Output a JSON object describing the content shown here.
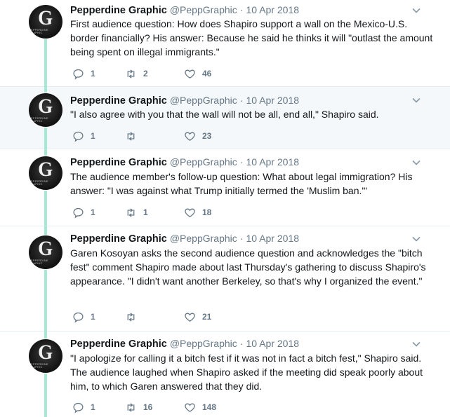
{
  "colors": {
    "thread_line": "#a5e8d4",
    "muted": "#657786",
    "text": "#14171a",
    "highlight_bg": "#f5f8fa"
  },
  "avatar": {
    "letter": "G",
    "sub": "PEPPERDINE GRAPHIC"
  },
  "tweets": [
    {
      "name": "Pepperdine Graphic",
      "handle": "@PeppGraphic",
      "sep": "·",
      "date": "10 Apr 2018",
      "text": "First audience question: How does Shapiro support a wall on the Mexico-U.S. border financially? His answer: Because he said he thinks it will \"outlast the amount being spent on illegal immigrants.\"",
      "replies": "1",
      "retweets": "2",
      "likes": "46"
    },
    {
      "name": "Pepperdine Graphic",
      "handle": "@PeppGraphic",
      "sep": "·",
      "date": "10 Apr 2018",
      "text": "\"I also agree with you that the wall will not be all, end all,\" Shapiro said.",
      "replies": "1",
      "retweets": "",
      "likes": "23"
    },
    {
      "name": "Pepperdine Graphic",
      "handle": "@PeppGraphic",
      "sep": "·",
      "date": "10 Apr 2018",
      "text": "The audience member's follow-up question: What about legal immigration? His answer: \"I was against what Trump initially termed the 'Muslim ban.'\"",
      "replies": "1",
      "retweets": "1",
      "likes": "18"
    },
    {
      "name": "Pepperdine Graphic",
      "handle": "@PeppGraphic",
      "sep": "·",
      "date": "10 Apr 2018",
      "text": "Garen Kosoyan asks the second audience question and acknowledges the \"bitch fest\" comment Shapiro made about last Thursday's gathering to discuss Shapiro's appearance. \"I didn't want another Berkeley, so that's why I organized the event.\"",
      "replies": "1",
      "retweets": "",
      "likes": "21"
    },
    {
      "name": "Pepperdine Graphic",
      "handle": "@PeppGraphic",
      "sep": "·",
      "date": "10 Apr 2018",
      "text": "\"I apologize for calling it a bitch fest if it was not in fact a bitch fest,\" Shapiro said. The audience laughed when Shapiro asked if the meeting did speak poorly about him, to which Garen answered that they did.",
      "replies": "1",
      "retweets": "16",
      "likes": "148"
    }
  ]
}
